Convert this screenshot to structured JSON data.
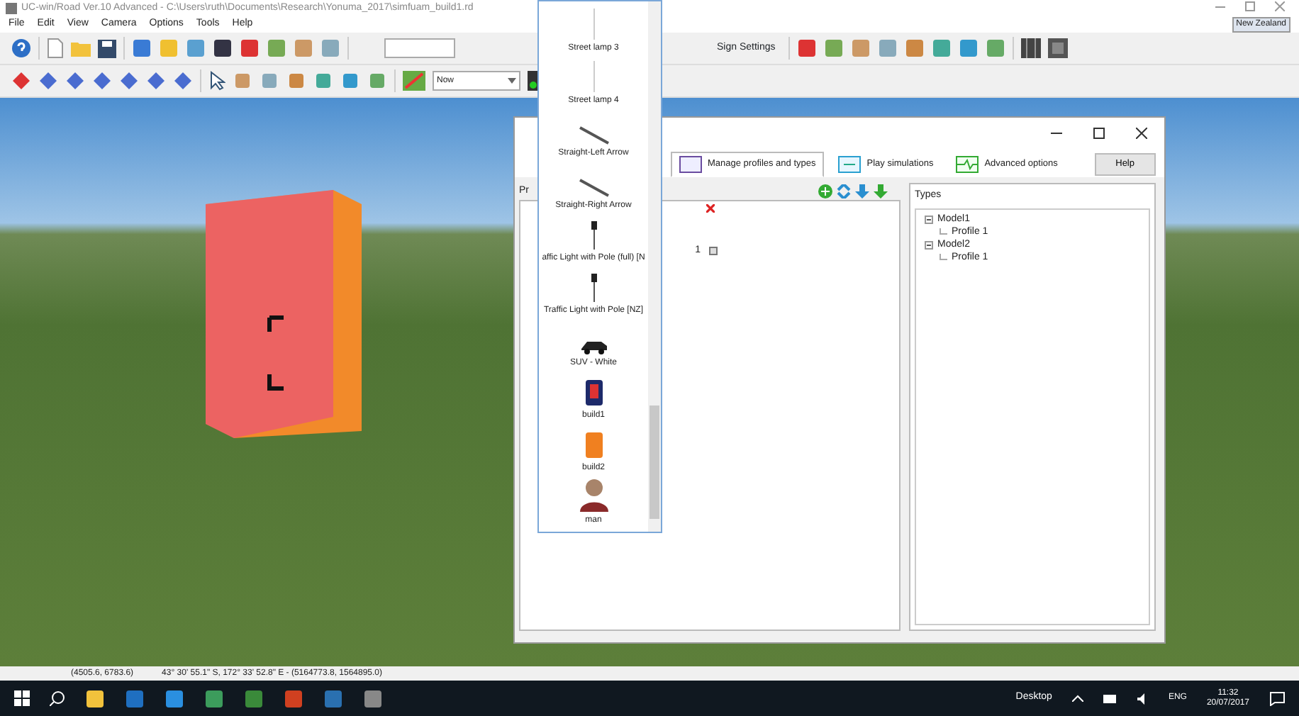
{
  "window": {
    "title": "UC-win/Road Ver.10 Advanced - C:\\Users\\ruth\\Documents\\Research\\Yonuma_2017\\simfuam_build1.rd",
    "tooltip": "New Zealand"
  },
  "menu": [
    "File",
    "Edit",
    "View",
    "Camera",
    "Options",
    "Tools",
    "Help"
  ],
  "toolbar": {
    "time_combo": "Now",
    "sign_settings": "Sign Settings"
  },
  "object_list": {
    "items": [
      {
        "label": "Street lamp 3",
        "kind": "lamp"
      },
      {
        "label": "Street lamp 4",
        "kind": "lamp"
      },
      {
        "label": "Straight-Left Arrow",
        "kind": "arrow"
      },
      {
        "label": "Straight-Right Arrow",
        "kind": "arrow"
      },
      {
        "label": "affic Light with Pole (full) [N",
        "kind": "signal"
      },
      {
        "label": "Traffic Light with Pole [NZ]",
        "kind": "signal"
      },
      {
        "label": "SUV - White",
        "kind": "car"
      },
      {
        "label": "build1",
        "kind": "building"
      },
      {
        "label": "build2",
        "kind": "building"
      },
      {
        "label": "man",
        "kind": "person"
      }
    ]
  },
  "dialog": {
    "tabs": [
      {
        "label": "Manage profiles and types",
        "selected": true
      },
      {
        "label": "Play simulations",
        "selected": false
      },
      {
        "label": "Advanced options",
        "selected": false
      }
    ],
    "help": "Help",
    "left_label": "Pr",
    "rows": [
      {
        "number": "1"
      }
    ],
    "types_label": "Types",
    "types_tree": [
      {
        "label": "Model1",
        "children": [
          {
            "label": "Profile 1"
          }
        ]
      },
      {
        "label": "Model2",
        "children": [
          {
            "label": "Profile 1"
          }
        ]
      }
    ]
  },
  "status_bar": {
    "position": "(4505.6, 6783.6)",
    "coordinates": "43° 30' 55.1\" S, 172° 33' 52.8\" E - (5164773.8, 1564895.0)"
  },
  "taskbar": {
    "desktop": "Desktop",
    "language": "ENG",
    "time": "11:32",
    "date": "20/07/2017"
  }
}
